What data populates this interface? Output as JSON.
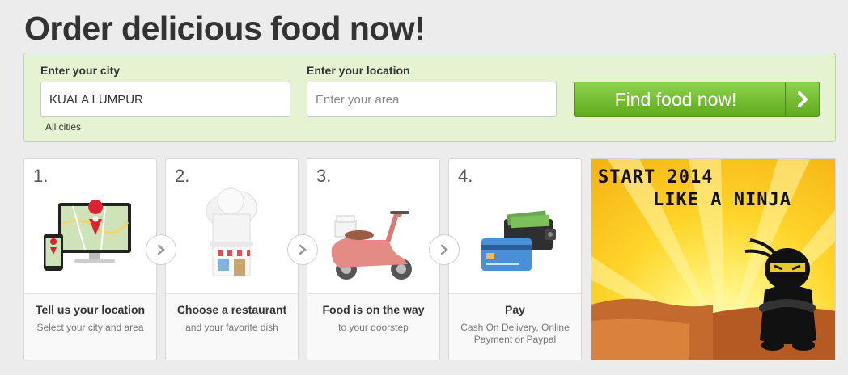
{
  "page": {
    "title": "Order delicious food now!"
  },
  "search": {
    "city_label": "Enter your city",
    "city_value": "KUALA LUMPUR",
    "all_cities_link": "All cities",
    "location_label": "Enter your location",
    "location_placeholder": "Enter your area",
    "submit_label": "Find food now!"
  },
  "steps": [
    {
      "number": "1.",
      "title": "Tell us your location",
      "subtitle": "Select your city and area",
      "icon": "map-devices-icon"
    },
    {
      "number": "2.",
      "title": "Choose a restaurant",
      "subtitle": "and your favorite dish",
      "icon": "chef-hat-icon"
    },
    {
      "number": "3.",
      "title": "Food is on the way",
      "subtitle": "to your doorstep",
      "icon": "scooter-icon"
    },
    {
      "number": "4.",
      "title": "Pay",
      "subtitle": "Cash On Delivery, Online Payment or Paypal",
      "icon": "wallet-card-icon"
    }
  ],
  "promo": {
    "line1": "START 2014",
    "line2": "LIKE A NINJA"
  },
  "colors": {
    "accent_green": "#6dbb2a",
    "panel_bg": "#e6f3d2",
    "promo_yellow": "#ffd52a"
  }
}
